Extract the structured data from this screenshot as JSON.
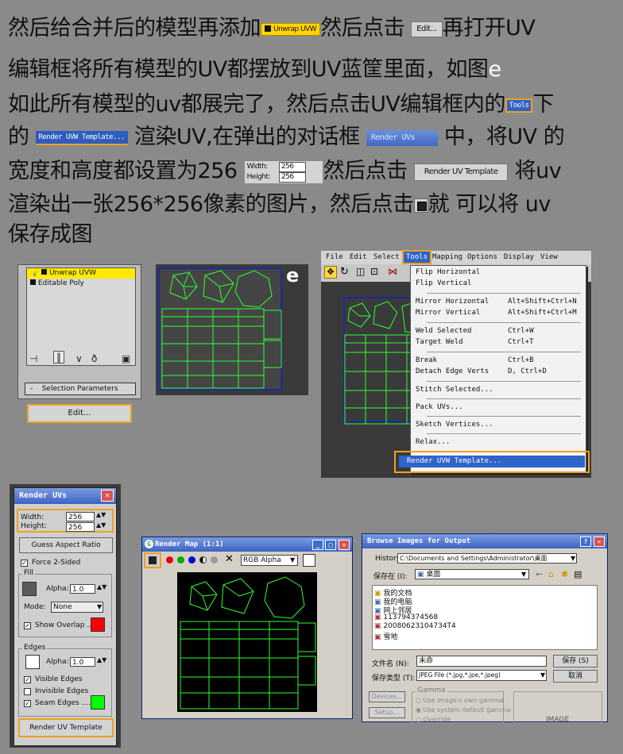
{
  "instructions": {
    "line1": {
      "a": "然后给合并后的模型再添加",
      "chip": "Unwrap UVW",
      "b": "然后点击",
      "btn": "Edit...",
      "c": "再打开UV"
    },
    "line2": {
      "a": "编辑框将所有模型的UV都摆放到UV蓝筐里面，如图",
      "b": "e"
    },
    "line3": {
      "a": "如此所有模型的uv都展完了，然后点击UV编辑框内的",
      "chip": "Tools",
      "b": "下"
    },
    "line4": {
      "a": "的",
      "chip": "Render UVW Template...",
      "b": "渲染UV,在弹出的对话框",
      "title": "Render UVs",
      "c": "中，将UV 的"
    },
    "line5": {
      "a": "宽度和高度都设置为256",
      "width_label": "Width:",
      "height_label": "Height:",
      "width_val": "256",
      "height_val": "256",
      "b": "然后点击",
      "btn": "Render UV Template",
      "c": "将uv"
    },
    "line6": {
      "a": "渲染出一张256*256像素的图片，然后点击",
      "b": "就 可以将 uv"
    },
    "line7": {
      "a": "保存成图"
    }
  },
  "modifier_panel": {
    "stack": [
      "Unwrap UVW",
      "Editable Poly"
    ],
    "rollout": "Selection Parameters",
    "edit_button": "Edit..."
  },
  "uv_view_label": "e",
  "tools_menu": {
    "menubar": [
      "File",
      "Edit",
      "Select",
      "Tools",
      "Mapping",
      "Options",
      "Display",
      "View"
    ],
    "items": [
      {
        "label": "Flip Horizontal",
        "shortcut": ""
      },
      {
        "label": "Flip Vertical",
        "shortcut": ""
      },
      {
        "label": "Mirror Horizontal",
        "shortcut": "Alt+Shift+Ctrl+N"
      },
      {
        "label": "Mirror Vertical",
        "shortcut": "Alt+Shift+Ctrl+M"
      },
      {
        "label": "Weld Selected",
        "shortcut": "Ctrl+W"
      },
      {
        "label": "Target Weld",
        "shortcut": "Ctrl+T"
      },
      {
        "label": "Break",
        "shortcut": "Ctrl+B"
      },
      {
        "label": "Detach Edge Verts",
        "shortcut": "D, Ctrl+D"
      },
      {
        "label": "Stitch Selected...",
        "shortcut": ""
      },
      {
        "label": "Pack UVs...",
        "shortcut": ""
      },
      {
        "label": "Sketch Vertices...",
        "shortcut": ""
      },
      {
        "label": "Relax...",
        "shortcut": ""
      },
      {
        "label": "Render UVW Template...",
        "shortcut": ""
      }
    ]
  },
  "render_uvs": {
    "title": "Render UVs",
    "width_label": "Width:",
    "width": "256",
    "height_label": "Height:",
    "height": "256",
    "guess_btn": "Guess Aspect Ratio",
    "force": "Force 2-Sided",
    "fill_group": "Fill",
    "alpha_label": "Alpha:",
    "fill_alpha": "1.0",
    "mode_label": "Mode:",
    "mode": "None",
    "show_overlap": "Show Overlap ...",
    "edges_group": "Edges",
    "edges_alpha": "1.0",
    "visible_edges": "Visible Edges",
    "invisible_edges": "Invisible Edges",
    "seam_edges": "Seam Edges ....",
    "render_btn": "Render UV Template",
    "colors": {
      "overlap": "#ff0000",
      "seam": "#00ff00"
    }
  },
  "render_map": {
    "title": "Render Map (1:1)",
    "channel": "RGB Alpha"
  },
  "browse": {
    "title": "Browse Images for Output",
    "history_label": "History:",
    "history": "C:\\Documents and Settings\\Administrator\\桌面",
    "savein_label": "保存在 (I):",
    "savein": "桌面",
    "files": [
      "我的文档",
      "我的电脑",
      "网上邻居",
      "113794374568",
      "20080623104734T4",
      "雪地"
    ],
    "filename_label": "文件名 (N):",
    "filename": "未命",
    "filetype_label": "保存类型 (T):",
    "filetype": "JPEG File (*.jpg,*.jpe,*.jpeg)",
    "save_btn": "保存 (S)",
    "cancel_btn": "取消",
    "devices_btn": "Devices...",
    "setup_btn": "Setup...",
    "gamma_group": "Gamma",
    "gamma_opt1": "Use image's own gamma",
    "gamma_opt2": "Use system default gamma",
    "gamma_opt3": "Override",
    "image_label": "IMAGE"
  }
}
